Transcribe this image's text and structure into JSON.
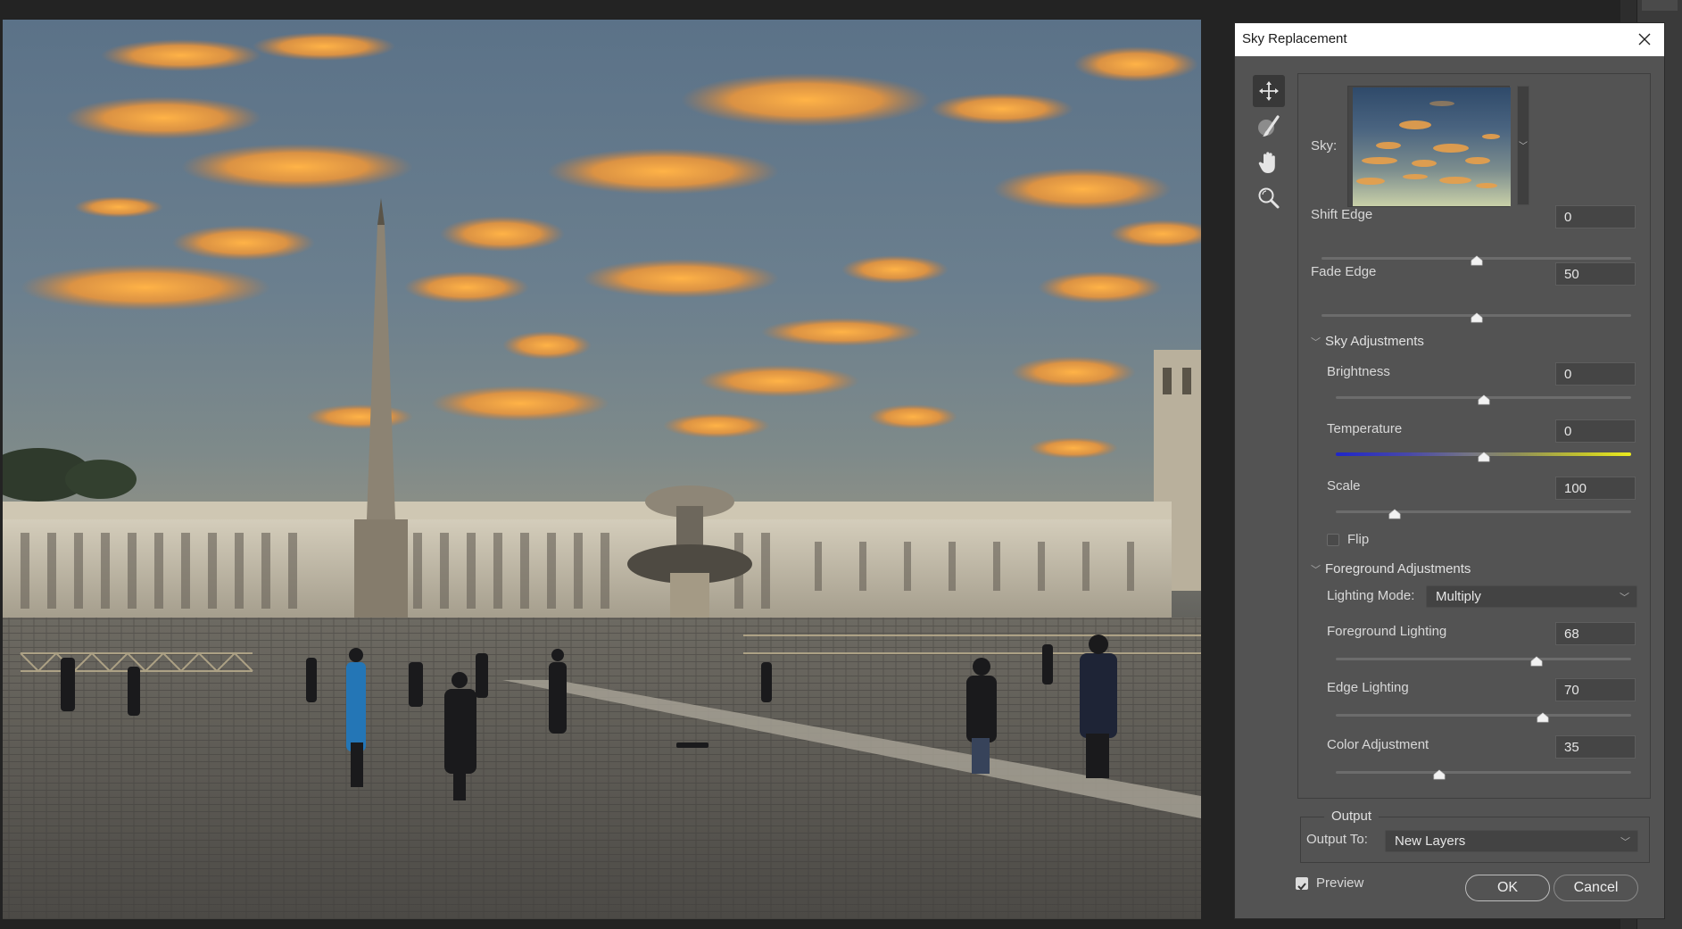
{
  "canvas": {
    "description": "St. Peter's Square photo with replaced sunset sky",
    "colors": {
      "sky": "#5b7288",
      "clouds": "#f0a040",
      "stone": "#c9c2b0",
      "pavement": "#55534f"
    }
  },
  "dialog": {
    "title": "Sky Replacement",
    "close_icon": "close-icon",
    "tools": [
      {
        "name": "move-tool",
        "icon": "move-icon",
        "active": true
      },
      {
        "name": "sky-brush-tool",
        "icon": "sky-brush-icon",
        "active": false
      },
      {
        "name": "hand-tool",
        "icon": "hand-icon",
        "active": false
      },
      {
        "name": "zoom-tool",
        "icon": "zoom-icon",
        "active": false
      }
    ],
    "sky": {
      "label": "Sky:",
      "preset": "sunset clouds"
    },
    "shift_edge": {
      "label": "Shift Edge",
      "value": "0",
      "min": -100,
      "max": 100
    },
    "fade_edge": {
      "label": "Fade Edge",
      "value": "50",
      "min": 0,
      "max": 100
    },
    "sky_adjustments": {
      "header": "Sky Adjustments",
      "expanded": true,
      "brightness": {
        "label": "Brightness",
        "value": "0",
        "min": -100,
        "max": 100
      },
      "temperature": {
        "label": "Temperature",
        "value": "0",
        "min": -100,
        "max": 100,
        "gradient": [
          "#1f26c9",
          "#ecec1e"
        ]
      },
      "scale": {
        "label": "Scale",
        "value": "100",
        "min": 25,
        "max": 400
      },
      "flip": {
        "label": "Flip",
        "checked": false
      }
    },
    "foreground_adjustments": {
      "header": "Foreground Adjustments",
      "expanded": true,
      "lighting_mode": {
        "label": "Lighting Mode:",
        "value": "Multiply"
      },
      "foreground_lighting": {
        "label": "Foreground Lighting",
        "value": "68",
        "min": 0,
        "max": 100
      },
      "edge_lighting": {
        "label": "Edge Lighting",
        "value": "70",
        "min": 0,
        "max": 100
      },
      "color_adjustment": {
        "label": "Color Adjustment",
        "value": "35",
        "min": 0,
        "max": 100
      }
    },
    "output": {
      "legend": "Output",
      "output_to_label": "Output To:",
      "output_to_value": "New Layers"
    },
    "preview": {
      "label": "Preview",
      "checked": true
    },
    "ok_label": "OK",
    "cancel_label": "Cancel"
  }
}
